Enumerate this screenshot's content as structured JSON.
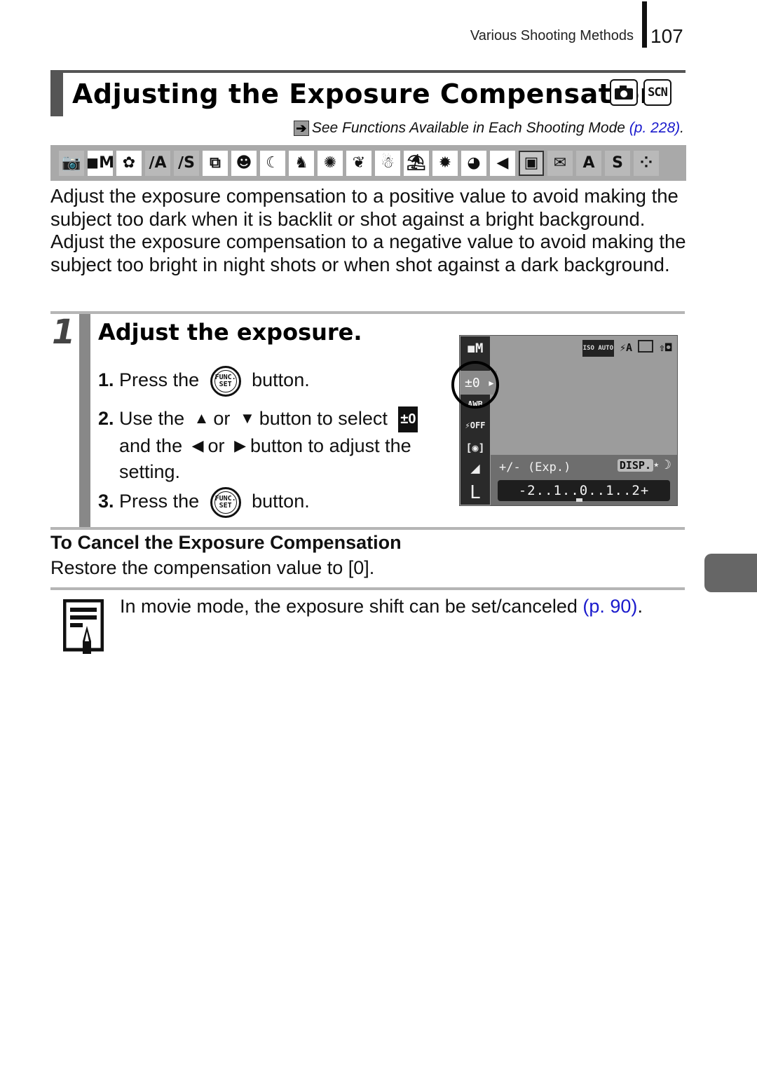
{
  "running_header": {
    "section": "Various Shooting Methods",
    "page_number": "107"
  },
  "title": {
    "text": "Adjusting the Exposure Compensation",
    "mode_badges": [
      {
        "icon": "camera-icon",
        "label": ""
      },
      {
        "icon": "scn-icon",
        "label": "SCN"
      }
    ]
  },
  "see_functions": {
    "arrow_icon": "right-arrow-icon",
    "text": "See Functions Available in Each Shooting Mode ",
    "link": "(p. 228)",
    "trailing": "."
  },
  "mode_strip": [
    {
      "name": "auto",
      "glyph": "📷",
      "available": false
    },
    {
      "name": "manual",
      "glyph": "◼M",
      "available": true
    },
    {
      "name": "digital-macro",
      "glyph": "✿",
      "available": true
    },
    {
      "name": "color-accent",
      "glyph": "∕A",
      "available": false
    },
    {
      "name": "color-swap",
      "glyph": "∕S",
      "available": false
    },
    {
      "name": "stitch-assist",
      "glyph": "⧉",
      "available": true
    },
    {
      "name": "portrait",
      "glyph": "☻",
      "available": true
    },
    {
      "name": "night-snapshot",
      "glyph": "☾",
      "available": true
    },
    {
      "name": "kids-pets",
      "glyph": "♞",
      "available": true
    },
    {
      "name": "indoor",
      "glyph": "✺",
      "available": true
    },
    {
      "name": "foliage",
      "glyph": "❦",
      "available": true
    },
    {
      "name": "snow",
      "glyph": "☃",
      "available": true
    },
    {
      "name": "beach",
      "glyph": "⛱",
      "available": true
    },
    {
      "name": "fireworks",
      "glyph": "✹",
      "available": true
    },
    {
      "name": "aquarium",
      "glyph": "◕",
      "available": true
    },
    {
      "name": "underwater",
      "glyph": "◀",
      "available": true
    },
    {
      "name": "movie-standard",
      "glyph": "▣",
      "available": false,
      "framed": true
    },
    {
      "name": "movie-email",
      "glyph": "✉",
      "available": false
    },
    {
      "name": "movie-color-accent",
      "glyph": "A",
      "available": false
    },
    {
      "name": "movie-color-swap",
      "glyph": "S",
      "available": false
    },
    {
      "name": "movie-time-lapse",
      "glyph": "⁘",
      "available": false
    }
  ],
  "intro": "Adjust the exposure compensation to a positive value to avoid making the subject too dark when it is backlit or shot against a bright background. Adjust the exposure compensation to a negative value to avoid making the subject too bright in night shots or when shot against a dark background.",
  "step": {
    "number": "1",
    "title": "Adjust the exposure.",
    "substeps": [
      {
        "num": "1.",
        "pre": "Press the",
        "button": "FUNC. SET",
        "post": "button."
      },
      {
        "num": "2.",
        "pre": "Use the",
        "or1": "or",
        "mid": "button to select",
        "setting_glyph": "±0",
        "line2_pre": "and the",
        "or2": "or",
        "line2_post": "button to adjust the",
        "line3": "setting."
      },
      {
        "num": "3.",
        "pre": "Press the",
        "button": "FUNC. SET",
        "post": "button."
      }
    ],
    "arrows": {
      "up": "▲",
      "down": "▼",
      "left": "◀",
      "right": "▶"
    }
  },
  "lcd": {
    "side_items": [
      "◼M",
      "AWB",
      "⚡OFF",
      "[◉]",
      "◢",
      "L"
    ],
    "selected": "±0 ▸",
    "top_icons": [
      "ISO AUTO",
      "⚡A",
      "",
      "⇧◘"
    ],
    "exp_label": "+/- (Exp.)",
    "disp_label": "DISP.",
    "scale": "-2..1..0..1..2+",
    "current_value": 0
  },
  "cancel": {
    "title": "To Cancel the Exposure Compensation",
    "text": "Restore the compensation value to [0]."
  },
  "note": {
    "text": "In movie mode, the exposure shift can be set/canceled ",
    "link": "(p. 90)",
    "trailing": "."
  },
  "colors": {
    "link": "#1a1acc",
    "band": "#555555",
    "strip_bg": "#a9a9a9",
    "side_tab": "#666666"
  }
}
